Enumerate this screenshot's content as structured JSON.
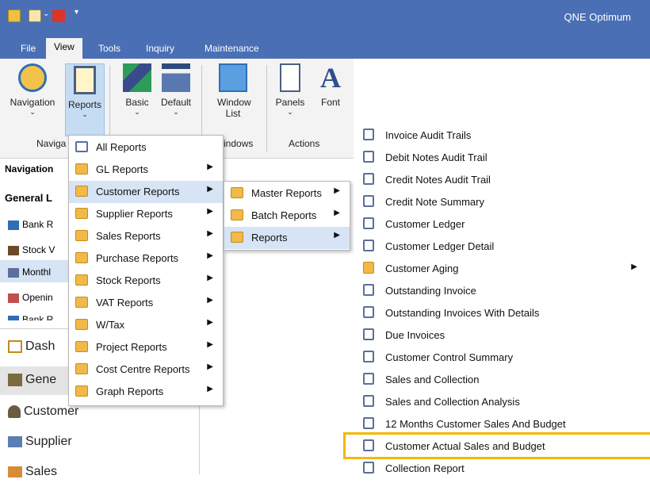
{
  "app": {
    "title": "QNE Optimum"
  },
  "tabs": [
    "File",
    "View",
    "Tools",
    "Inquiry",
    "Maintenance"
  ],
  "ribbon": {
    "buttons": [
      "Navigation",
      "Reports",
      "Basic",
      "Default",
      "Window List",
      "Panels",
      "Font"
    ],
    "groups": [
      "Naviga",
      "indows",
      "Actions"
    ]
  },
  "left_panel": {
    "header": "Navigation",
    "section": "General L",
    "items": [
      "Bank R",
      "Stock V",
      "Monthl",
      "Openin",
      "Bank R"
    ],
    "big_items": [
      "Dash",
      "Gene",
      "Customer",
      "Supplier",
      "Sales"
    ]
  },
  "menu1": [
    "All Reports",
    "GL Reports",
    "Customer Reports",
    "Supplier Reports",
    "Sales Reports",
    "Purchase Reports",
    "Stock Reports",
    "VAT Reports",
    "W/Tax",
    "Project Reports",
    "Cost Centre Reports",
    "Graph Reports"
  ],
  "menu2": [
    "Master Reports",
    "Batch Reports",
    "Reports"
  ],
  "menu3": [
    "Invoice Audit Trails",
    "Debit Notes Audit Trail",
    "Credit Notes Audit Trail",
    "Credit Note Summary",
    "Customer Ledger",
    "Customer Ledger Detail",
    "Customer Aging",
    "Outstanding Invoice",
    "Outstanding Invoices With Details",
    "Due Invoices",
    "Customer Control Summary",
    "Sales and Collection",
    "Sales and Collection Analysis",
    "12 Months Customer Sales And Budget",
    "Customer Actual Sales and Budget",
    "Collection Report"
  ],
  "colors": {
    "titlebar": "#4a6fb5",
    "highlight_menu": "#d6e4f5",
    "annotation": "#f5b800"
  }
}
